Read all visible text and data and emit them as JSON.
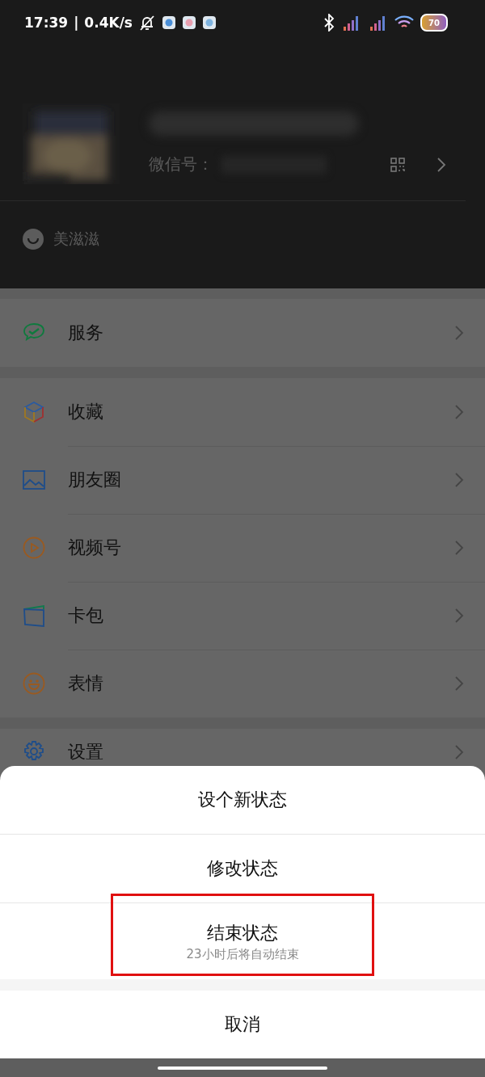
{
  "status_bar": {
    "time": "17:39",
    "separator": "|",
    "speed": "0.4K/s",
    "battery": "70"
  },
  "profile": {
    "wechat_id_label": "微信号：",
    "status": "美滋滋"
  },
  "menu_groups": [
    {
      "items": [
        {
          "label": "服务",
          "kind": "service"
        }
      ]
    },
    {
      "items": [
        {
          "label": "收藏",
          "kind": "favorites"
        },
        {
          "label": "朋友圈",
          "kind": "moments"
        },
        {
          "label": "视频号",
          "kind": "channels"
        },
        {
          "label": "卡包",
          "kind": "cards"
        },
        {
          "label": "表情",
          "kind": "stickers"
        }
      ]
    },
    {
      "items": [
        {
          "label": "设置",
          "kind": "settings"
        }
      ]
    }
  ],
  "action_sheet": {
    "options": [
      {
        "label": "设个新状态",
        "highlighted": false
      },
      {
        "label": "修改状态",
        "highlighted": false
      },
      {
        "label": "结束状态",
        "subtitle": "23小时后将自动结束",
        "highlighted": true
      }
    ],
    "cancel": "取消"
  }
}
